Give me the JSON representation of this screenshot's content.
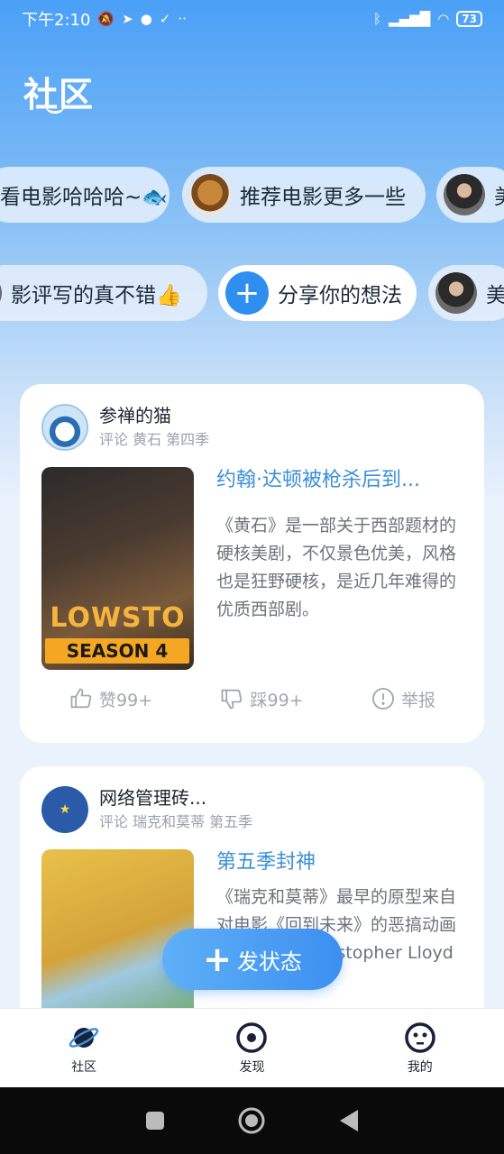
{
  "status_bar": {
    "time": "下午2:10",
    "icons_left": [
      "mute-icon",
      "telegram-icon",
      "chat-icon",
      "check-icon",
      "more-icon"
    ],
    "icons_right": [
      "bluetooth-icon",
      "signal-icon",
      "wifi-icon"
    ],
    "battery": "73"
  },
  "header": {
    "title": "社区"
  },
  "bubbles_row1": [
    {
      "text": "看电影哈哈哈~🐟",
      "avatar": "none"
    },
    {
      "text": "推荐电影更多一些",
      "avatar": "lion"
    },
    {
      "text": "美",
      "avatar": "woman"
    }
  ],
  "bubbles_row2": [
    {
      "text": "影评写的真不错👍",
      "avatar": "partial"
    },
    {
      "text": "分享你的想法",
      "avatar": "plus"
    },
    {
      "text": "美",
      "avatar": "woman"
    }
  ],
  "posts": [
    {
      "author": "参禅的猫",
      "meta": "评论 黄石 第四季",
      "title": "约翰·达顿被枪杀后到...",
      "content": "《黄石》是一部关于西部题材的硬核美剧，不仅景色优美，风格也是狂野硬核，是近几年难得的优质西部剧。",
      "poster_text": "LOWSTO",
      "poster_season": "SEASON 4",
      "like_label": "赞99+",
      "dislike_label": "踩99+",
      "report_label": "举报"
    },
    {
      "author": "网络管理砖...",
      "meta": "评论 瑞克和莫蒂 第五季",
      "title": "第五季封神",
      "content": "《瑞克和莫蒂》最早的原型来自对电影《回到未来》的恶搞动画短片，如今Christopher Lloyd亲自"
    }
  ],
  "fab": {
    "label": "发状态"
  },
  "bottom_nav": [
    {
      "label": "社区",
      "icon": "planet-icon"
    },
    {
      "label": "发现",
      "icon": "eye-icon"
    },
    {
      "label": "我的",
      "icon": "face-icon"
    }
  ],
  "colors": {
    "accent": "#3a8fd8",
    "primary_blue": "#2f8ff0"
  }
}
